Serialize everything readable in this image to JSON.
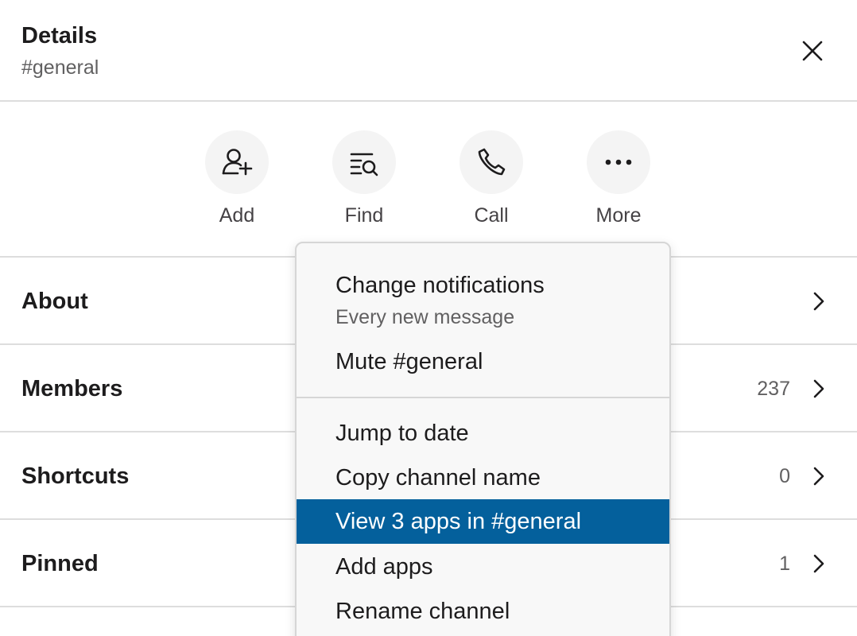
{
  "header": {
    "title": "Details",
    "subtitle": "#general",
    "close_icon": "close-icon"
  },
  "actions": [
    {
      "label": "Add",
      "icon": "add-user-icon"
    },
    {
      "label": "Find",
      "icon": "find-icon"
    },
    {
      "label": "Call",
      "icon": "phone-icon"
    },
    {
      "label": "More",
      "icon": "more-icon"
    }
  ],
  "rows": [
    {
      "label": "About",
      "count": ""
    },
    {
      "label": "Members",
      "count": "237"
    },
    {
      "label": "Shortcuts",
      "count": "0"
    },
    {
      "label": "Pinned",
      "count": "1"
    }
  ],
  "menu": {
    "change_notifications": "Change notifications",
    "notifications_value": "Every new message",
    "mute": "Mute #general",
    "jump_to_date": "Jump to date",
    "copy_channel_name": "Copy channel name",
    "view_apps": "View 3 apps in #general",
    "add_apps": "Add apps",
    "rename_channel": "Rename channel"
  },
  "colors": {
    "highlight": "#04609c",
    "divider": "#dddddd",
    "button_bg": "#f4f4f4"
  }
}
